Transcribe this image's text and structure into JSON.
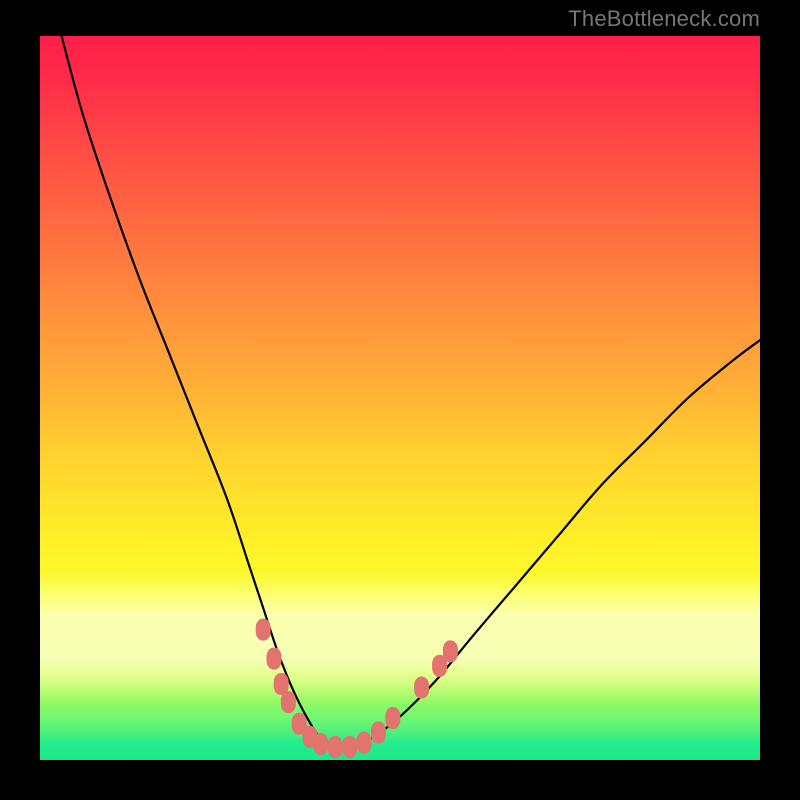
{
  "watermark": "TheBottleneck.com",
  "chart_data": {
    "type": "line",
    "title": "",
    "xlabel": "",
    "ylabel": "",
    "xlim": [
      0,
      100
    ],
    "ylim": [
      0,
      100
    ],
    "grid": false,
    "legend": false,
    "series": [
      {
        "name": "bottleneck-curve",
        "x": [
          3,
          6,
          10,
          14,
          18,
          22,
          26,
          29,
          31,
          33,
          35,
          37,
          39,
          41,
          43,
          46,
          50,
          55,
          60,
          66,
          72,
          78,
          84,
          90,
          96,
          100
        ],
        "y": [
          100,
          89,
          77,
          66,
          56,
          46,
          36,
          27,
          21,
          15,
          10,
          6,
          3,
          2,
          2,
          3,
          6,
          11,
          17,
          24,
          31,
          38,
          44,
          50,
          55,
          58
        ]
      }
    ],
    "markers": {
      "name": "highlight-band",
      "color": "#e2736e",
      "points": [
        {
          "x": 31.0,
          "y": 18.0
        },
        {
          "x": 32.5,
          "y": 14.0
        },
        {
          "x": 33.5,
          "y": 10.5
        },
        {
          "x": 34.5,
          "y": 8.0
        },
        {
          "x": 36.0,
          "y": 5.0
        },
        {
          "x": 37.5,
          "y": 3.2
        },
        {
          "x": 39.0,
          "y": 2.2
        },
        {
          "x": 41.0,
          "y": 1.8
        },
        {
          "x": 43.0,
          "y": 1.8
        },
        {
          "x": 45.0,
          "y": 2.4
        },
        {
          "x": 47.0,
          "y": 3.8
        },
        {
          "x": 49.0,
          "y": 5.8
        },
        {
          "x": 53.0,
          "y": 10.0
        },
        {
          "x": 55.5,
          "y": 13.0
        },
        {
          "x": 57.0,
          "y": 15.0
        }
      ]
    },
    "background_gradient": {
      "stops": [
        {
          "pos": 0,
          "color": "#ff1f49"
        },
        {
          "pos": 36,
          "color": "#ff8a3d"
        },
        {
          "pos": 70,
          "color": "#fff028"
        },
        {
          "pos": 94,
          "color": "#74f870"
        },
        {
          "pos": 100,
          "color": "#19e98a"
        }
      ]
    }
  }
}
